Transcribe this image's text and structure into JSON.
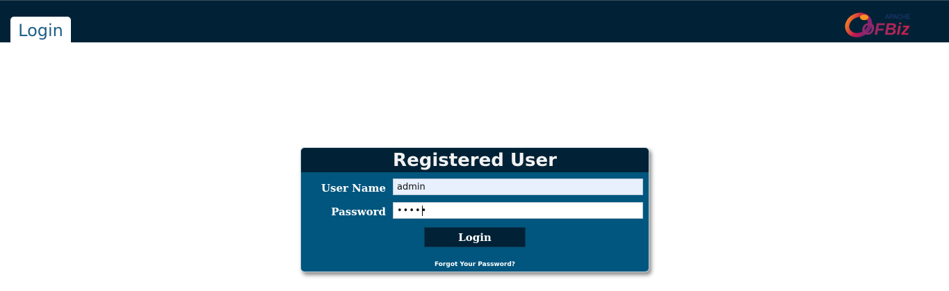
{
  "header": {
    "tab_label": "Login",
    "logo_text": "OFBiz",
    "logo_small_text": "APACHE"
  },
  "login": {
    "title": "Registered User",
    "username_label": "User Name",
    "username_value": "admin",
    "password_label": "Password",
    "password_value": "admin",
    "button_label": "Login",
    "forgot_label": "Forgot Your Password?"
  },
  "colors": {
    "header_bg": "#012236",
    "panel_bg": "#00567f",
    "tab_text": "#1e5f86"
  }
}
